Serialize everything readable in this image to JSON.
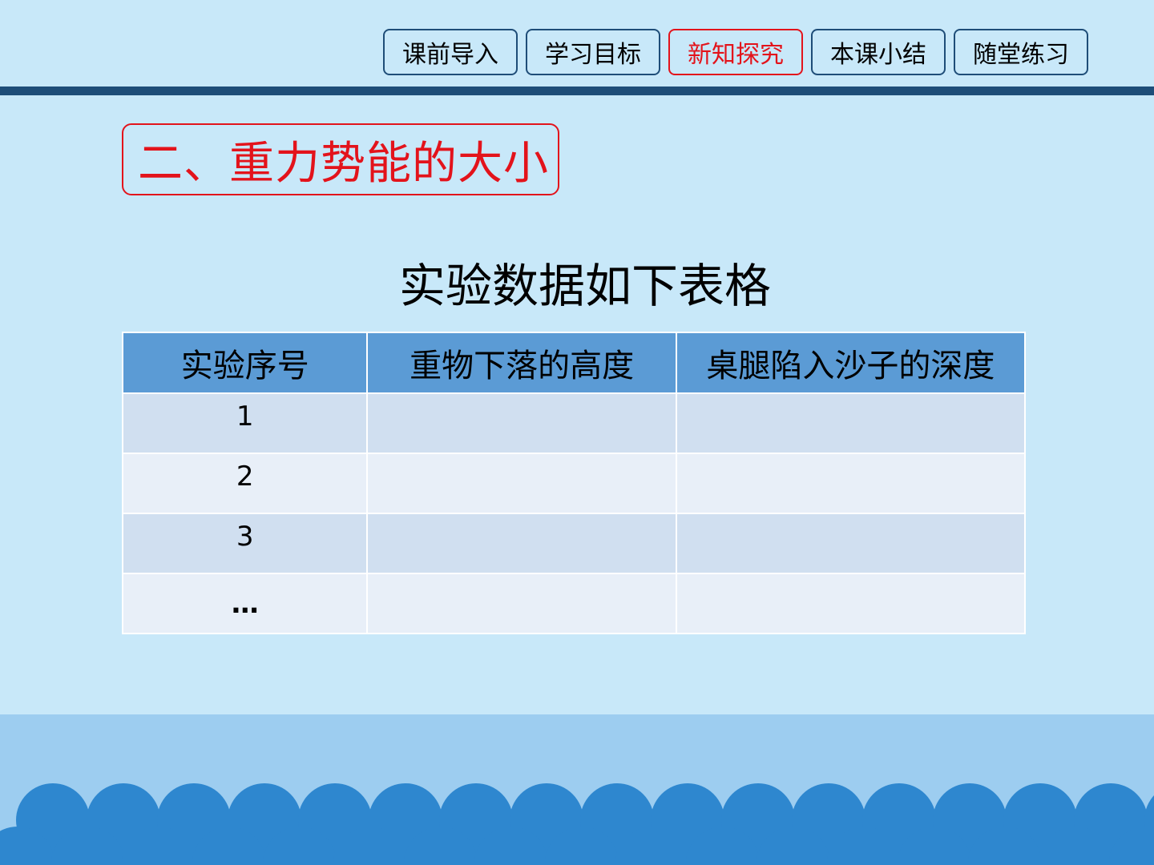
{
  "nav": {
    "tabs": [
      {
        "label": "课前导入",
        "active": false
      },
      {
        "label": "学习目标",
        "active": false
      },
      {
        "label": "新知探究",
        "active": true
      },
      {
        "label": "本课小结",
        "active": false
      },
      {
        "label": "随堂练习",
        "active": false
      }
    ]
  },
  "section": {
    "title": "二、重力势能的大小"
  },
  "table": {
    "caption": "实验数据如下表格",
    "headers": [
      "实验序号",
      "重物下落的高度",
      "桌腿陷入沙子的深度"
    ],
    "rows": [
      [
        "1",
        "",
        ""
      ],
      [
        "2",
        "",
        ""
      ],
      [
        "3",
        "",
        ""
      ],
      [
        "…",
        "",
        ""
      ]
    ]
  },
  "colors": {
    "background": "#c8e8f9",
    "divider": "#1e4d78",
    "accent_red": "#e3131b",
    "table_header": "#5b9bd5",
    "row_odd": "#d0dff0",
    "row_even": "#e8eff8",
    "wave": "#2e87cf"
  }
}
